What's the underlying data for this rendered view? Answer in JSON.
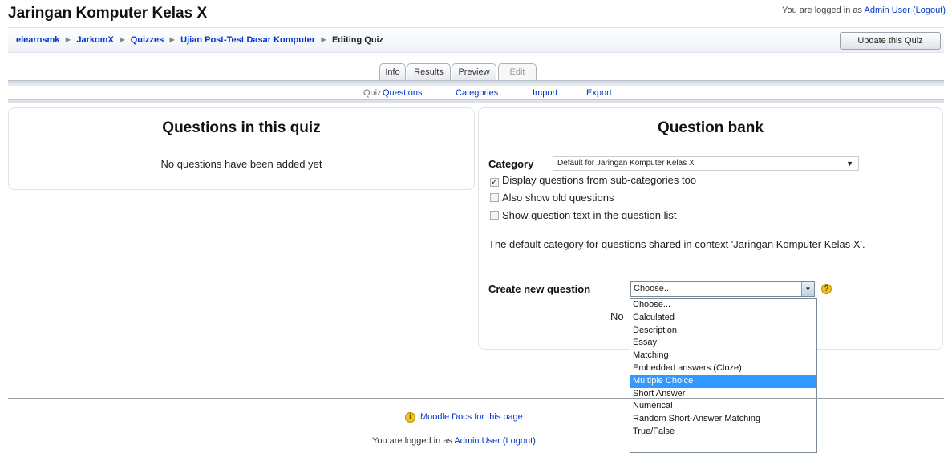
{
  "header": {
    "title": "Jaringan Komputer Kelas X",
    "login_prefix": "You are logged in as",
    "user_name": "Admin User",
    "logout": "(Logout)"
  },
  "breadcrumb": {
    "items": [
      "elearnsmk",
      "JarkomX",
      "Quizzes",
      "Ujian Post-Test Dasar Komputer"
    ],
    "current": "Editing Quiz",
    "separator": "►"
  },
  "toolbar": {
    "update_label": "Update this Quiz"
  },
  "tabs": {
    "items": [
      "Info",
      "Results",
      "Preview",
      "Edit"
    ],
    "sub_items": [
      "Quiz",
      "Questions",
      "Categories",
      "Import",
      "Export"
    ]
  },
  "quiz_panel": {
    "title": "Questions in this quiz",
    "empty_message": "No questions have been added yet"
  },
  "bank_panel": {
    "title": "Question bank",
    "category_label": "Category",
    "category_value": "Default for Jaringan Komputer Kelas X",
    "checkboxes": [
      {
        "label": "Display questions from sub-categories too",
        "checked": true
      },
      {
        "label": "Also show old questions",
        "checked": false
      },
      {
        "label": "Show question text in the question list",
        "checked": false
      }
    ],
    "description": "The default category for questions shared in context 'Jaringan Komputer Kelas X'.",
    "create_label": "Create new question",
    "create_value": "Choose...",
    "hidden_text": "No"
  },
  "dropdown": {
    "selected": "Multiple Choice",
    "options": [
      "Choose...",
      "Calculated",
      "Description",
      "Essay",
      "Matching",
      "Embedded answers (Cloze)",
      "Multiple Choice",
      "Short Answer",
      "Numerical",
      "Random Short-Answer Matching",
      "True/False"
    ]
  },
  "footer": {
    "docs_link": "Moodle Docs for this page",
    "login_prefix": "You are logged in as",
    "user_name": "Admin User",
    "logout": "(Logout)"
  },
  "icons": {
    "help": "help-icon",
    "checkbox": "checkbox-icon",
    "dropdown_arrow": "chevron-down-icon"
  },
  "colors": {
    "link": "#0033cc",
    "selected_option": "#3399ff",
    "help_icon": "#f3c21b"
  }
}
